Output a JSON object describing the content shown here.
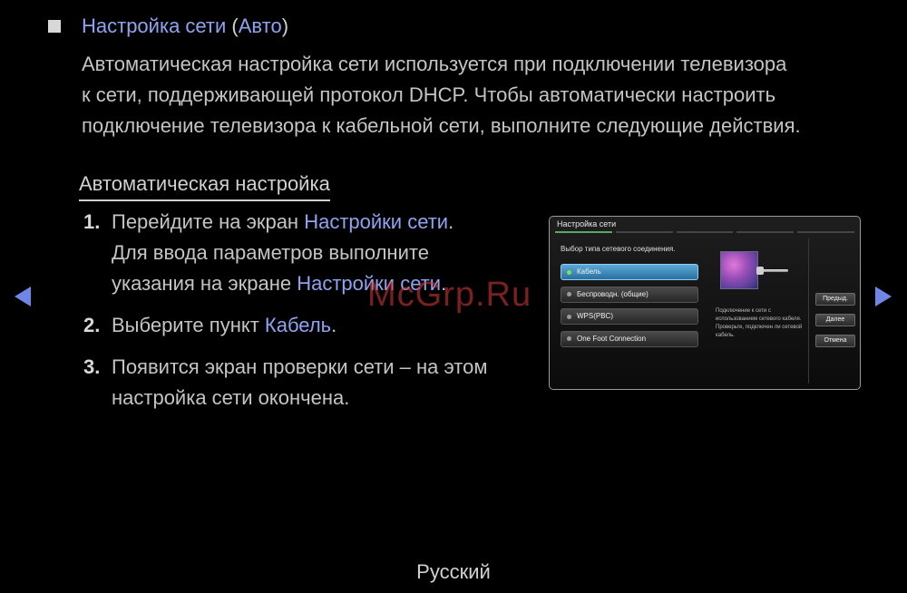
{
  "header": {
    "title_main": "Настройка сети",
    "title_open": " (",
    "title_accent": "Авто",
    "title_close": ")"
  },
  "intro_lines": [
    "Автоматическая настройка сети используется при подключении телевизора",
    "к сети, поддерживающей протокол DHCP. Чтобы автоматически настроить",
    "подключение телевизора к кабельной сети, выполните следующие действия."
  ],
  "subheading": "Автоматическая настройка",
  "steps": {
    "s1": {
      "num": "1.",
      "l1_pre": "Перейдите на экран ",
      "l1_accent": "Настройки сети",
      "l1_post": ".",
      "l2": "Для ввода параметров выполните",
      "l3_pre": "указания на экране ",
      "l3_accent": "Настройки сети",
      "l3_post": "."
    },
    "s2": {
      "num": "2.",
      "l1_pre": "Выберите пункт ",
      "l1_accent": "Кабель",
      "l1_post": "."
    },
    "s3": {
      "num": "3.",
      "l1": "Появится экран проверки сети – на этом",
      "l2": "настройка сети окончена."
    }
  },
  "watermark": "McGrp.Ru",
  "tv": {
    "title": "Настройка сети",
    "prompt": "Выбор типа сетевого соединения.",
    "options": [
      "Кабель",
      "Беспроводн. (общие)",
      "WPS(PBC)",
      "One Foot Connection"
    ],
    "desc": "Подключение к сети с использованием сетевого кабеля. Проверьте, подключен ли сетевой кабель.",
    "buttons": [
      "Предыд.",
      "Далее",
      "Отмена"
    ]
  },
  "footer": "Русский",
  "icons": {
    "left": "triangle-left-icon",
    "right": "triangle-right-icon",
    "bullet": "square-bullet-icon"
  },
  "colors": {
    "accent": "#8ea4f0",
    "arrow": "#6f86e6",
    "selected_option": "#3f8fc2"
  }
}
